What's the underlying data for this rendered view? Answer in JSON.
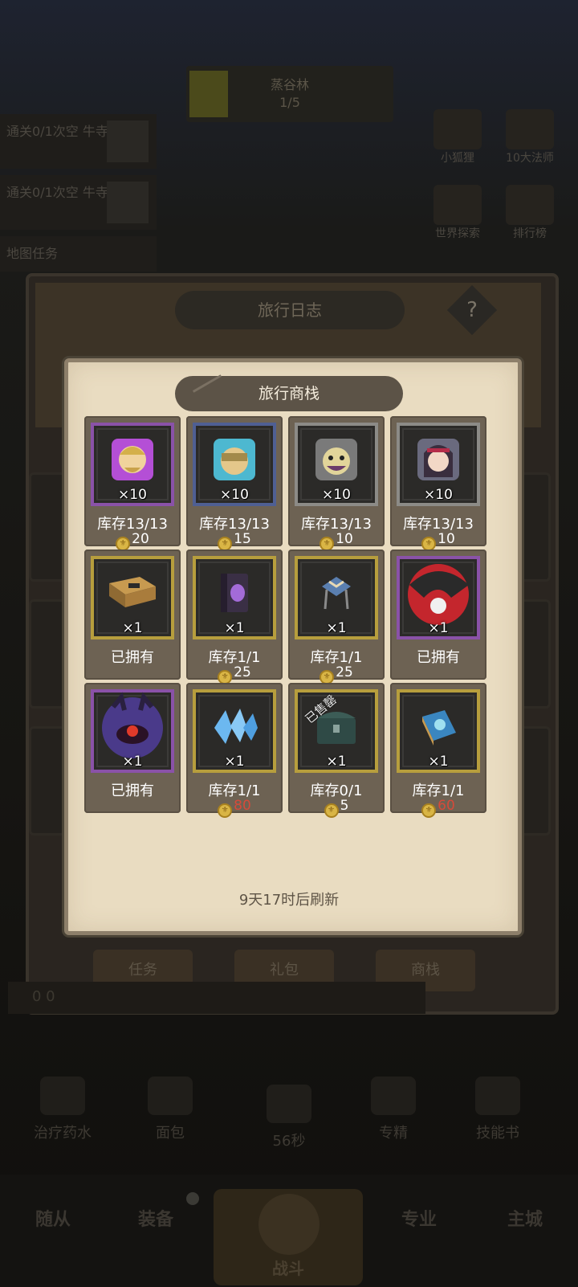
{
  "background": {
    "top_card": {
      "line1": "蒸谷林",
      "line2": "1/5"
    },
    "quests": [
      {
        "label": "通关0/1次空\n牛寺"
      },
      {
        "label": "通关0/1次空\n牛寺"
      },
      {
        "label": "地图任务"
      }
    ],
    "right_buttons": [
      "小狐狸",
      "10大法师",
      "世界探索",
      "排行榜"
    ],
    "log_title": "旅行日志",
    "help": "?",
    "tabs": [
      "任务",
      "礼包",
      "商栈"
    ],
    "res_text": "0     0",
    "quick_items": [
      "治疗药水",
      "面包",
      "56秒",
      "专精",
      "技能书"
    ],
    "nav": {
      "left1": "随从",
      "left2": "装备",
      "center": "战斗",
      "right1": "专业",
      "right2": "主城"
    }
  },
  "shop": {
    "title": "旅行商栈",
    "refresh_text": "9天17时后刷新",
    "items": [
      {
        "frame": "purple",
        "art": "hero-face-purple",
        "qty": "×10",
        "stock": "库存13/13",
        "price": "20",
        "price_color": "#ffffff"
      },
      {
        "frame": "blue",
        "art": "hero-face-blue",
        "qty": "×10",
        "stock": "库存13/13",
        "price": "15",
        "price_color": "#ffffff"
      },
      {
        "frame": "gray",
        "art": "hero-face-gray",
        "qty": "×10",
        "stock": "库存13/13",
        "price": "10",
        "price_color": "#ffffff"
      },
      {
        "frame": "gray",
        "art": "hero-face-girl",
        "qty": "×10",
        "stock": "库存13/13",
        "price": "10",
        "price_color": "#ffffff"
      },
      {
        "frame": "gold",
        "art": "book-icon",
        "qty": "×1",
        "stock": "已拥有",
        "price": "",
        "price_color": "#ffffff"
      },
      {
        "frame": "gold",
        "art": "spellbook-icon",
        "qty": "×1",
        "stock": "库存1/1",
        "price": "25",
        "price_color": "#ffffff"
      },
      {
        "frame": "gold",
        "art": "stand-icon",
        "qty": "×1",
        "stock": "库存1/1",
        "price": "25",
        "price_color": "#ffffff"
      },
      {
        "frame": "purple",
        "art": "red-helmet-icon",
        "qty": "×1",
        "stock": "已拥有",
        "price": "",
        "price_color": "#ffffff"
      },
      {
        "frame": "purple",
        "art": "purple-monster-icon",
        "qty": "×1",
        "stock": "已拥有",
        "price": "",
        "price_color": "#ffffff"
      },
      {
        "frame": "gold",
        "art": "crystal-icon",
        "qty": "×1",
        "stock": "库存1/1",
        "price": "80",
        "price_color": "#d64a3a"
      },
      {
        "frame": "gold",
        "art": "chest-icon",
        "qty": "×1",
        "stock": "库存0/1",
        "price": "5",
        "price_color": "#ffffff",
        "sold": "已售罄"
      },
      {
        "frame": "gold",
        "art": "blue-book-icon",
        "qty": "×1",
        "stock": "库存1/1",
        "price": "60",
        "price_color": "#d64a3a"
      }
    ]
  }
}
